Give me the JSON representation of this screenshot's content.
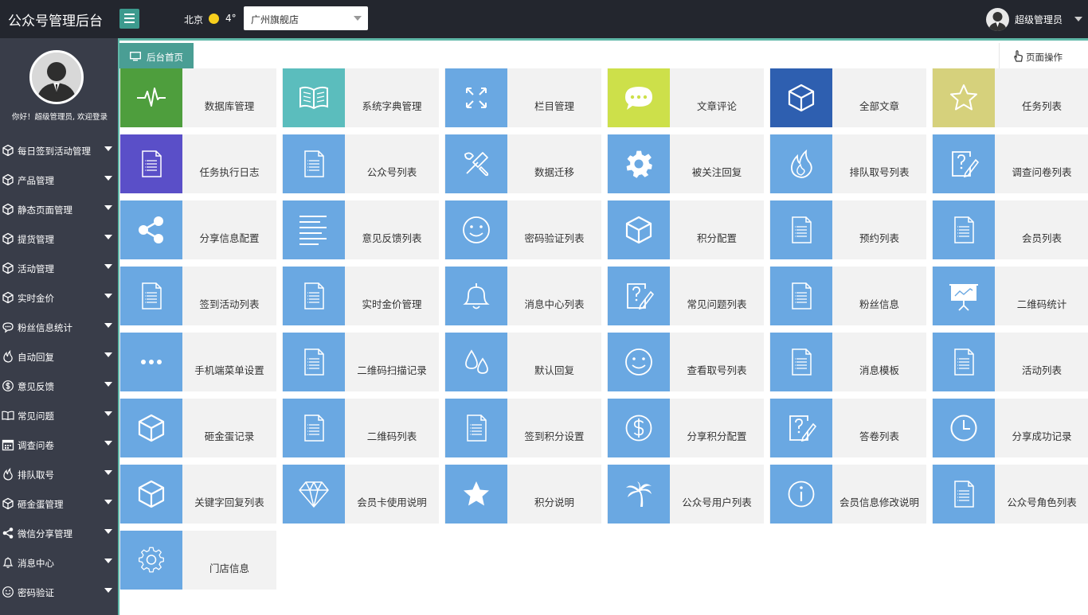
{
  "header": {
    "title": "公众号管理后台",
    "city": "北京",
    "temperature": "4°",
    "store_select": "广州旗舰店",
    "user_name": "超级管理员"
  },
  "sidebar": {
    "welcome": "你好！超级管理员, 欢迎登录",
    "items": [
      {
        "label": "每日签到活动管理",
        "icon": "cube-icon"
      },
      {
        "label": "产品管理",
        "icon": "cube-icon"
      },
      {
        "label": "静态页面管理",
        "icon": "cube-icon"
      },
      {
        "label": "提货管理",
        "icon": "cube-icon"
      },
      {
        "label": "活动管理",
        "icon": "cube-icon"
      },
      {
        "label": "实时金价",
        "icon": "cube-icon"
      },
      {
        "label": "粉丝信息统计",
        "icon": "chat-icon"
      },
      {
        "label": "自动回复",
        "icon": "fire-icon"
      },
      {
        "label": "意见反馈",
        "icon": "dollar-icon"
      },
      {
        "label": "常见问题",
        "icon": "book-icon"
      },
      {
        "label": "调查问卷",
        "icon": "calendar-icon"
      },
      {
        "label": "排队取号",
        "icon": "fire-icon"
      },
      {
        "label": "砸金蛋管理",
        "icon": "cube-icon"
      },
      {
        "label": "微信分享管理",
        "icon": "share-icon"
      },
      {
        "label": "消息中心",
        "icon": "bell-icon"
      },
      {
        "label": "密码验证",
        "icon": "smile-icon"
      }
    ]
  },
  "tabs": {
    "home": "后台首页",
    "page_ops": "页面操作"
  },
  "tiles": [
    {
      "label": "数据库管理",
      "icon": "pulse",
      "color": "#4e9e3d"
    },
    {
      "label": "系统字典管理",
      "icon": "book",
      "color": "#5bbdbd"
    },
    {
      "label": "栏目管理",
      "icon": "expand",
      "color": "#6aa8e2"
    },
    {
      "label": "文章评论",
      "icon": "chat",
      "color": "#cde04a"
    },
    {
      "label": "全部文章",
      "icon": "cube",
      "color": "#2e5fb0"
    },
    {
      "label": "任务列表",
      "icon": "star-outline",
      "color": "#d6d17c"
    },
    {
      "label": "任务执行日志",
      "icon": "doc",
      "color": "#5a4fc8"
    },
    {
      "label": "公众号列表",
      "icon": "doc",
      "color": "#6aa8e2"
    },
    {
      "label": "数据迁移",
      "icon": "tools",
      "color": "#6aa8e2"
    },
    {
      "label": "被关注回复",
      "icon": "gear-solid",
      "color": "#6aa8e2"
    },
    {
      "label": "排队取号列表",
      "icon": "fire",
      "color": "#6aa8e2"
    },
    {
      "label": "调查问卷列表",
      "icon": "question-edit",
      "color": "#6aa8e2"
    },
    {
      "label": "分享信息配置",
      "icon": "share",
      "color": "#6aa8e2"
    },
    {
      "label": "意见反馈列表",
      "icon": "lines",
      "color": "#6aa8e2"
    },
    {
      "label": "密码验证列表",
      "icon": "smile",
      "color": "#6aa8e2"
    },
    {
      "label": "积分配置",
      "icon": "cube",
      "color": "#6aa8e2"
    },
    {
      "label": "预约列表",
      "icon": "doc",
      "color": "#6aa8e2"
    },
    {
      "label": "会员列表",
      "icon": "doc",
      "color": "#6aa8e2"
    },
    {
      "label": "签到活动列表",
      "icon": "doc",
      "color": "#6aa8e2"
    },
    {
      "label": "实时金价管理",
      "icon": "doc",
      "color": "#6aa8e2"
    },
    {
      "label": "消息中心列表",
      "icon": "bell",
      "color": "#6aa8e2"
    },
    {
      "label": "常见问题列表",
      "icon": "question-edit",
      "color": "#6aa8e2"
    },
    {
      "label": "粉丝信息",
      "icon": "doc",
      "color": "#6aa8e2"
    },
    {
      "label": "二维码统计",
      "icon": "presentation",
      "color": "#6aa8e2"
    },
    {
      "label": "手机端菜单设置",
      "icon": "dots",
      "color": "#6aa8e2"
    },
    {
      "label": "二维码扫描记录",
      "icon": "doc",
      "color": "#6aa8e2"
    },
    {
      "label": "默认回复",
      "icon": "drops",
      "color": "#6aa8e2"
    },
    {
      "label": "查看取号列表",
      "icon": "smile",
      "color": "#6aa8e2"
    },
    {
      "label": "消息模板",
      "icon": "doc",
      "color": "#6aa8e2"
    },
    {
      "label": "活动列表",
      "icon": "doc",
      "color": "#6aa8e2"
    },
    {
      "label": "砸金蛋记录",
      "icon": "cube",
      "color": "#6aa8e2"
    },
    {
      "label": "二维码列表",
      "icon": "doc",
      "color": "#6aa8e2"
    },
    {
      "label": "签到积分设置",
      "icon": "doc",
      "color": "#6aa8e2"
    },
    {
      "label": "分享积分配置",
      "icon": "dollar",
      "color": "#6aa8e2"
    },
    {
      "label": "答卷列表",
      "icon": "question-edit",
      "color": "#6aa8e2"
    },
    {
      "label": "分享成功记录",
      "icon": "clock",
      "color": "#6aa8e2"
    },
    {
      "label": "关键字回复列表",
      "icon": "cube",
      "color": "#6aa8e2"
    },
    {
      "label": "会员卡使用说明",
      "icon": "diamond",
      "color": "#6aa8e2"
    },
    {
      "label": "积分说明",
      "icon": "star",
      "color": "#6aa8e2"
    },
    {
      "label": "公众号用户列表",
      "icon": "palm",
      "color": "#6aa8e2"
    },
    {
      "label": "会员信息修改说明",
      "icon": "info",
      "color": "#6aa8e2"
    },
    {
      "label": "公众号角色列表",
      "icon": "doc",
      "color": "#6aa8e2"
    },
    {
      "label": "门店信息",
      "icon": "gear-outline",
      "color": "#6aa8e2"
    }
  ]
}
